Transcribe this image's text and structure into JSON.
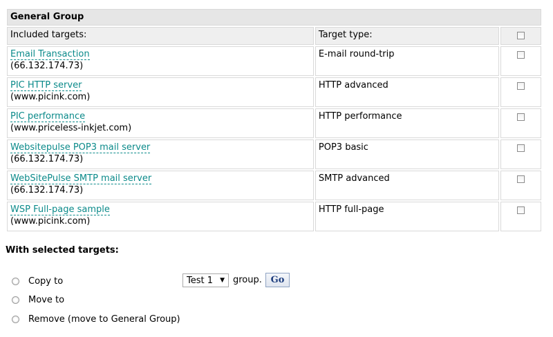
{
  "group": {
    "title": "General Group",
    "headers": {
      "included_targets": "Included targets:",
      "target_type": "Target type:"
    },
    "targets": [
      {
        "name": "Email Transaction",
        "host": "(66.132.174.73)",
        "type": "E-mail round-trip"
      },
      {
        "name": "PIC HTTP server",
        "host": "(www.picink.com)",
        "type": "HTTP advanced"
      },
      {
        "name": "PIC performance",
        "host": "(www.priceless-inkjet.com)",
        "type": "HTTP performance"
      },
      {
        "name": "Websitepulse POP3 mail server",
        "host": "(66.132.174.73)",
        "type": "POP3 basic"
      },
      {
        "name": "WebSitePulse SMTP mail server",
        "host": "(66.132.174.73)",
        "type": "SMTP advanced"
      },
      {
        "name": "WSP Full-page sample",
        "host": "(www.picink.com)",
        "type": "HTTP full-page"
      }
    ]
  },
  "actions": {
    "title": "With selected targets:",
    "options": [
      {
        "label": "Copy to"
      },
      {
        "label": "Move to"
      },
      {
        "label": "Remove (move to General Group)"
      }
    ],
    "group_select_value": "Test 1",
    "group_suffix": "group.",
    "go_label": "Go"
  },
  "colors": {
    "link": "#0b8a8a",
    "header_bg": "#efefef",
    "title_bg": "#e6e6e6",
    "go_text": "#1f3f7f"
  }
}
